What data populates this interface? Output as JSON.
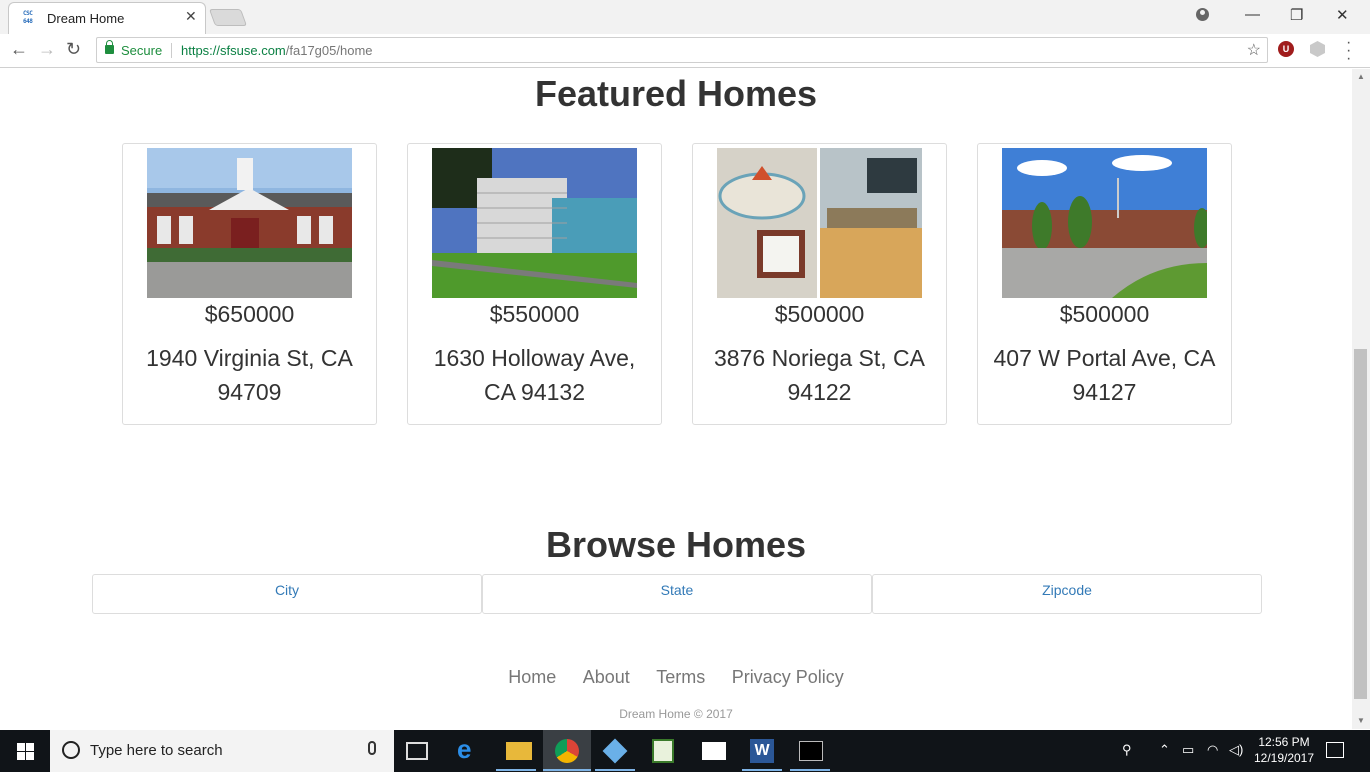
{
  "browser": {
    "tab_title": "Dream Home",
    "tab_favicon_text": "CSC648",
    "tab_close": "✕",
    "secure_label": "Secure",
    "url_host": "https://sfsuse.com",
    "url_path": "/fa17g05/home",
    "extension_badge": "U"
  },
  "featured": {
    "title": "Featured Homes",
    "homes": [
      {
        "price": "$650000",
        "address": "1940 Virginia St, CA 94709",
        "image": "school-building-photo"
      },
      {
        "price": "$550000",
        "address": "1630 Holloway Ave, CA 94132",
        "image": "glass-building-photo"
      },
      {
        "price": "$500000",
        "address": "3876 Noriega St, CA 94122",
        "image": "surf-shop-photo"
      },
      {
        "price": "$500000",
        "address": "407 W Portal Ave, CA 94127",
        "image": "brick-building-photo"
      }
    ]
  },
  "browse": {
    "title": "Browse Homes",
    "tabs": [
      "City",
      "State",
      "Zipcode"
    ]
  },
  "footer": {
    "links": [
      "Home",
      "About",
      "Terms",
      "Privacy Policy"
    ],
    "copyright": "Dream Home © 2017"
  },
  "taskbar": {
    "search_placeholder": "Type here to search",
    "time": "12:56 PM",
    "date": "12/19/2017"
  }
}
